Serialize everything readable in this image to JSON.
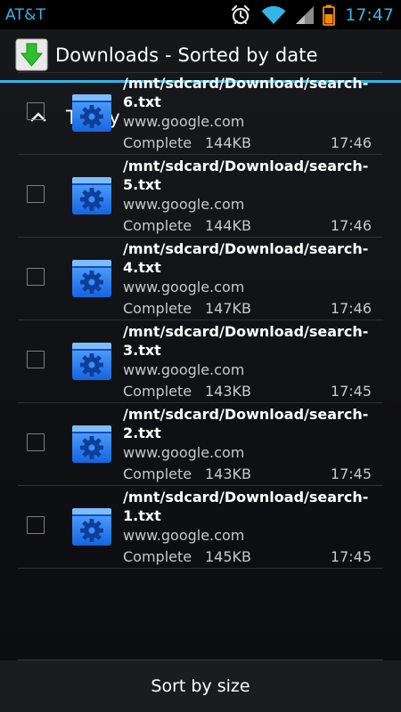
{
  "status_bar": {
    "carrier": "AT&T",
    "time": "17:47",
    "icons": [
      "alarm-icon",
      "wifi-icon",
      "signal-icon",
      "battery-icon"
    ],
    "accent_color": "#33b5e5"
  },
  "action_bar": {
    "title": "Downloads - Sorted by date",
    "icon": "download-arrow-icon"
  },
  "section": {
    "title": "Today",
    "expanded": true
  },
  "downloads": [
    {
      "path": "/mnt/sdcard/Download/search-6.txt",
      "source": "www.google.com",
      "status": "Complete",
      "size": "144KB",
      "time": "17:46"
    },
    {
      "path": "/mnt/sdcard/Download/search-5.txt",
      "source": "www.google.com",
      "status": "Complete",
      "size": "144KB",
      "time": "17:46"
    },
    {
      "path": "/mnt/sdcard/Download/search-4.txt",
      "source": "www.google.com",
      "status": "Complete",
      "size": "147KB",
      "time": "17:46"
    },
    {
      "path": "/mnt/sdcard/Download/search-3.txt",
      "source": "www.google.com",
      "status": "Complete",
      "size": "143KB",
      "time": "17:45"
    },
    {
      "path": "/mnt/sdcard/Download/search-2.txt",
      "source": "www.google.com",
      "status": "Complete",
      "size": "143KB",
      "time": "17:45"
    },
    {
      "path": "/mnt/sdcard/Download/search-1.txt",
      "source": "www.google.com",
      "status": "Complete",
      "size": "145KB",
      "time": "17:45"
    }
  ],
  "bottom_bar": {
    "sort_label": "Sort by size"
  }
}
